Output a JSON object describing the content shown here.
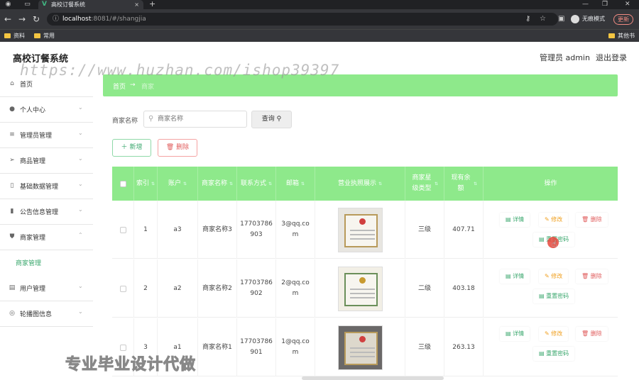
{
  "browser": {
    "tab_title": "高校订餐系统",
    "tab_close": "×",
    "new_tab": "+",
    "url_host": "localhost",
    "url_path": ":8081/#/shangjia",
    "incognito_label": "无痕模式",
    "update_label": "更新",
    "bookmarks": [
      "资料",
      "常用",
      "其他书签"
    ]
  },
  "header": {
    "title": "高校订餐系统",
    "admin": "管理员 admin",
    "logout": "退出登录"
  },
  "watermark": "https://www.huzhan.com/ishop39397",
  "sidebar": {
    "items": [
      {
        "label": "首页",
        "icon": "home-icon"
      },
      {
        "label": "个人中心",
        "icon": "user-icon"
      },
      {
        "label": "管理员管理",
        "icon": "list-icon"
      },
      {
        "label": "商品管理",
        "icon": "send-icon"
      },
      {
        "label": "基础数据管理",
        "icon": "phone-icon"
      },
      {
        "label": "公告信息管理",
        "icon": "chart-icon"
      },
      {
        "label": "商家管理",
        "icon": "shield-icon"
      },
      {
        "label": "用户管理",
        "icon": "card-icon"
      },
      {
        "label": "轮播图信息",
        "icon": "compass-icon"
      }
    ],
    "sub_item": "商家管理"
  },
  "breadcrumb": {
    "home": "首页",
    "sep": "→",
    "current": "商家"
  },
  "search": {
    "label": "商家名称",
    "placeholder": "商家名称",
    "button": "查询"
  },
  "toolbar": {
    "add": "新增",
    "delete": "删除"
  },
  "table": {
    "headers": [
      "索引",
      "账户",
      "商家名称",
      "联系方式",
      "邮箱",
      "营业执照展示",
      "商家星级类型",
      "现有余额",
      "操作"
    ],
    "rows": [
      {
        "index": "1",
        "account": "a3",
        "name": "商家名称3",
        "phone_1": "17703786",
        "phone_2": "903",
        "email_1": "3@qq.co",
        "email_2": "m",
        "star": "三级",
        "balance": "407.71"
      },
      {
        "index": "2",
        "account": "a2",
        "name": "商家名称2",
        "phone_1": "17703786",
        "phone_2": "902",
        "email_1": "2@qq.co",
        "email_2": "m",
        "star": "二级",
        "balance": "403.18"
      },
      {
        "index": "3",
        "account": "a1",
        "name": "商家名称1",
        "phone_1": "17703786",
        "phone_2": "901",
        "email_1": "1@qq.co",
        "email_2": "m",
        "star": "三级",
        "balance": "263.13"
      }
    ],
    "ops": {
      "detail": "详情",
      "edit": "修改",
      "remove": "删除",
      "reset": "重置密码"
    }
  },
  "promo": "专业毕业设计代做",
  "colors": {
    "accent": "#8ee98b",
    "primary_text": "#3aa76d",
    "danger": "#e05c5c",
    "warning": "#f0a020"
  }
}
